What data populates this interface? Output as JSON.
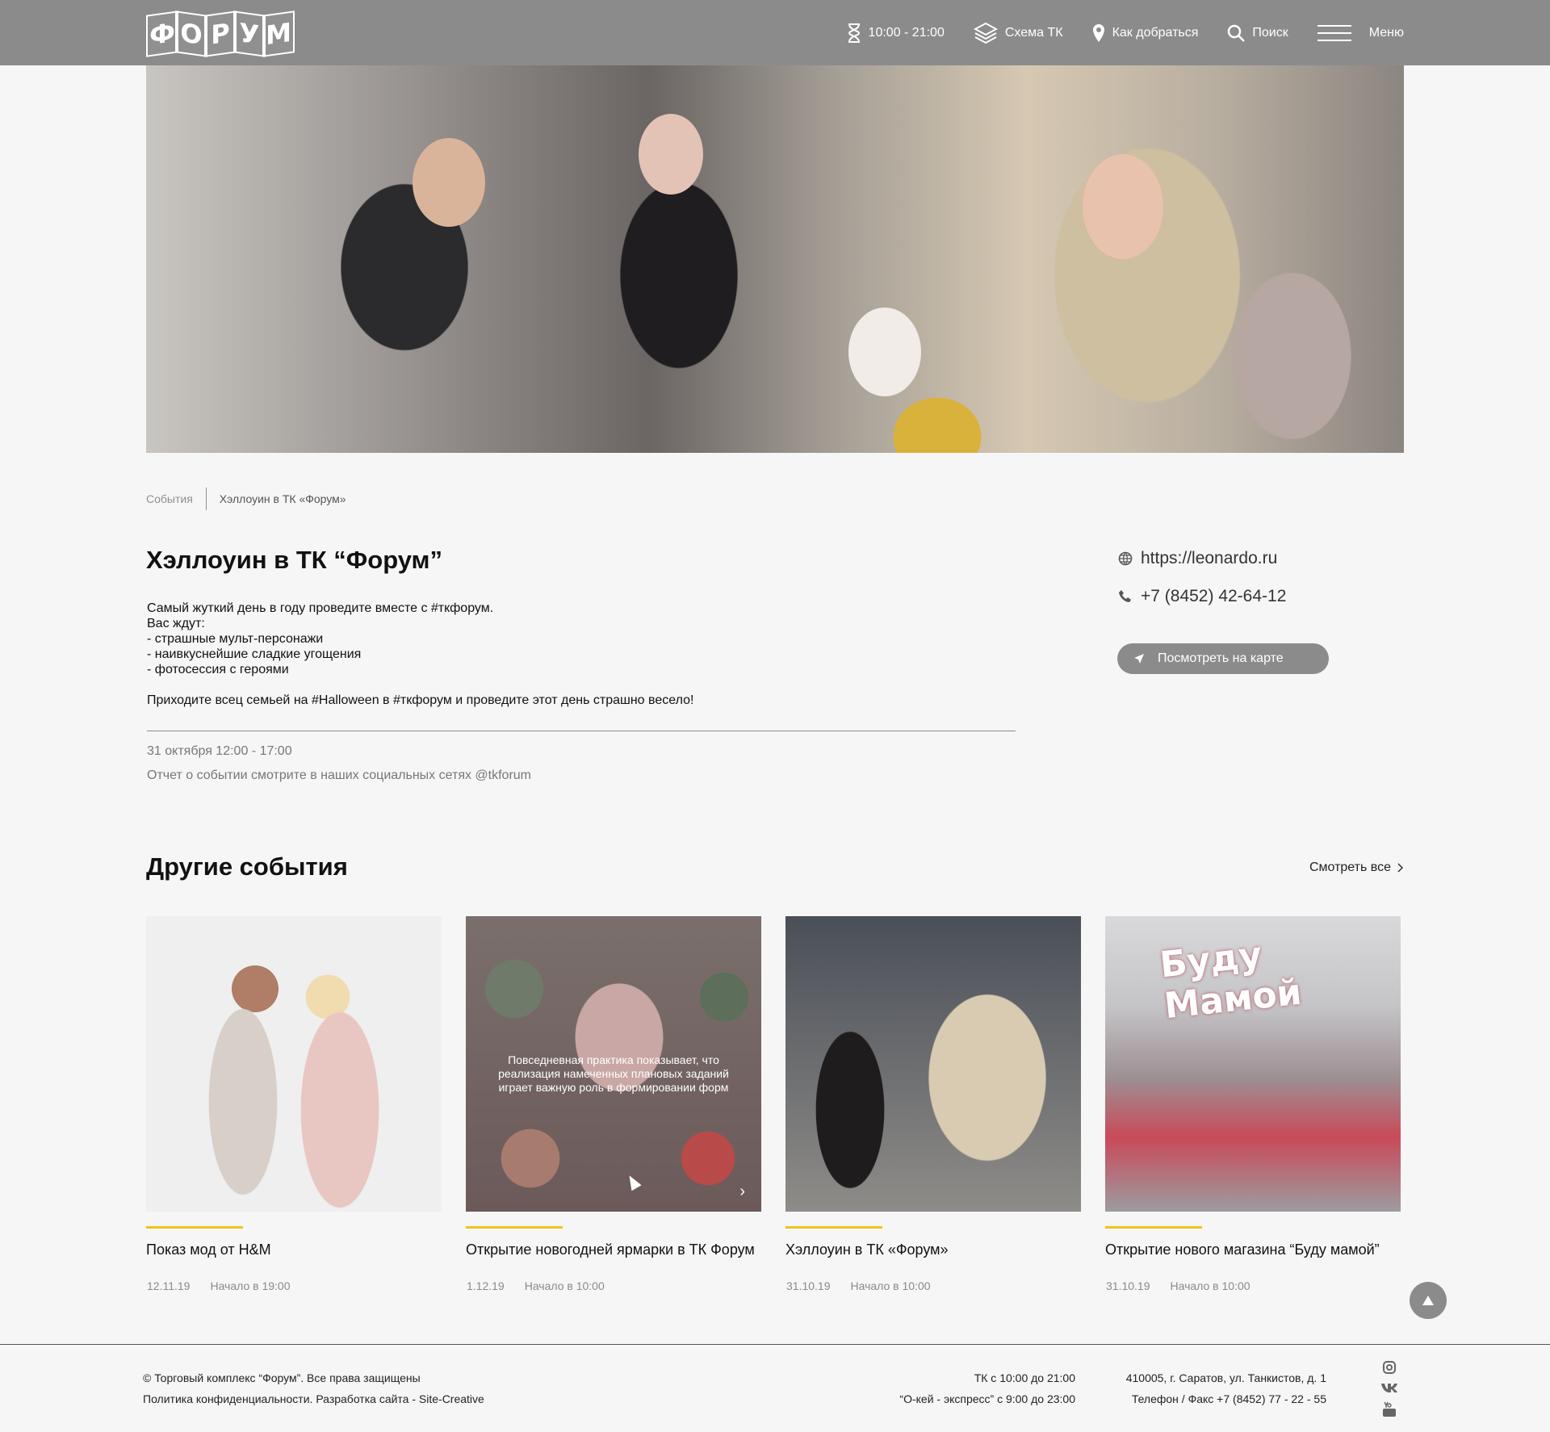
{
  "header": {
    "logo_letters": [
      "Ф",
      "О",
      "Р",
      "У",
      "М"
    ],
    "hours": "10:00 - 21:00",
    "scheme": "Схема ТК",
    "directions": "Как добраться",
    "search": "Поиск",
    "menu": "Меню"
  },
  "breadcrumb": {
    "parent": "События",
    "current": "Хэллоуин в ТК «Форум»"
  },
  "article": {
    "title": "Хэллоуин в ТК “Форум”",
    "description": "Самый жуткий день в году проведите вместе с #ткфорум.\nВас ждут:\n- страшные мульт-персонажи\n- наивкуснейшие сладкие угощения\n- фотосессия с героями\n\nПриходите всец семьей на #Halloween в #ткфорум и проведите этот день страшно весело!",
    "date": "31 октября 12:00 - 17:00",
    "report": "Отчет о событии смотрите в наших социальных сетях @tkforum"
  },
  "contacts": {
    "website": "https://leonardo.ru",
    "phone": "+7 (8452) 42-64-12",
    "map_button": "Посмотреть на карте"
  },
  "other_events": {
    "title": "Другие события",
    "see_all": "Смотреть все",
    "cards": [
      {
        "name": "Показ мод от H&M",
        "date": "12.11.19",
        "start": "Начало в 19:00"
      },
      {
        "name": "Открытие новогодней ярмарки в ТК Форум",
        "date": "1.12.19",
        "start": "Начало в 10:00",
        "overlay": "Повседневная практика показывает, что реализация намеченных плановых заданий играет важную роль в формировании форм"
      },
      {
        "name": "Хэллоуин в ТК «Форум»",
        "date": "31.10.19",
        "start": "Начало в 10:00"
      },
      {
        "name": "Открытие нового магазина “Буду мамой”",
        "date": "31.10.19",
        "start": "Начало в 10:00",
        "sign": "Буду Мамой"
      }
    ]
  },
  "footer": {
    "copyright": "© Торговый комплекс “Форум”. Все права защищены",
    "policy": "Политика конфиденциальности. Разработка сайта - Site-Creative",
    "hours_mall": "ТК с 10:00 до 21:00",
    "hours_express": "“О-кей - экспресс” с 9:00 до 23:00",
    "address": "410005, г. Саратов, ул. Танкистов, д. 1",
    "phone_fax": "Телефон / Факс +7 (8452) 77 - 22 - 55",
    "social": [
      "instagram-icon",
      "vk-icon",
      "youtube-icon"
    ]
  },
  "colors": {
    "header_bg": "#8c8b8c",
    "accent_bar": "#f0c419",
    "page_bg": "#f6f6f6"
  }
}
